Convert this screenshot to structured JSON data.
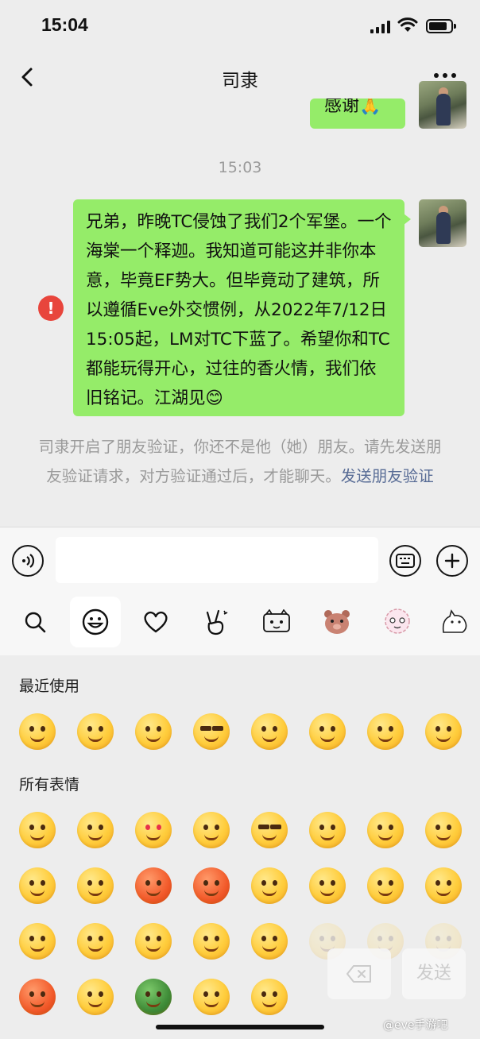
{
  "status_bar": {
    "time": "15:04"
  },
  "nav": {
    "title": "司隶"
  },
  "chat": {
    "top_bubble_text": "感谢🙏",
    "time_divider": "15:03",
    "main_message": "兄弟，昨晚TC侵蚀了我们2个军堡。一个海棠一个释迦。我知道可能这并非你本意，毕竟EF势大。但毕竟动了建筑，所以遵循Eve外交惯例，从2022年7/12日15:05起，LM对TC下蓝了。希望你和TC都能玩得开心，过往的香火情，我们依旧铭记。江湖见😊",
    "error_mark": "!",
    "system_notice": "司隶开启了朋友验证，你还不是他（她）朋友。请先发送朋友验证请求，对方验证通过后，才能聊天。",
    "system_link": "发送朋友验证"
  },
  "input_bar": {
    "placeholder": ""
  },
  "emoji_tabs": [
    "search-icon",
    "emoji-icon",
    "heart-icon",
    "victory-hand-icon",
    "sticker-cat-icon",
    "sticker-bear-icon",
    "sticker-sheep-icon",
    "sticker-cat2-icon"
  ],
  "emoji_panel": {
    "recent_title": "最近使用",
    "all_title": "所有表情",
    "send_label": "发送"
  },
  "watermark": "@eve手游吧"
}
